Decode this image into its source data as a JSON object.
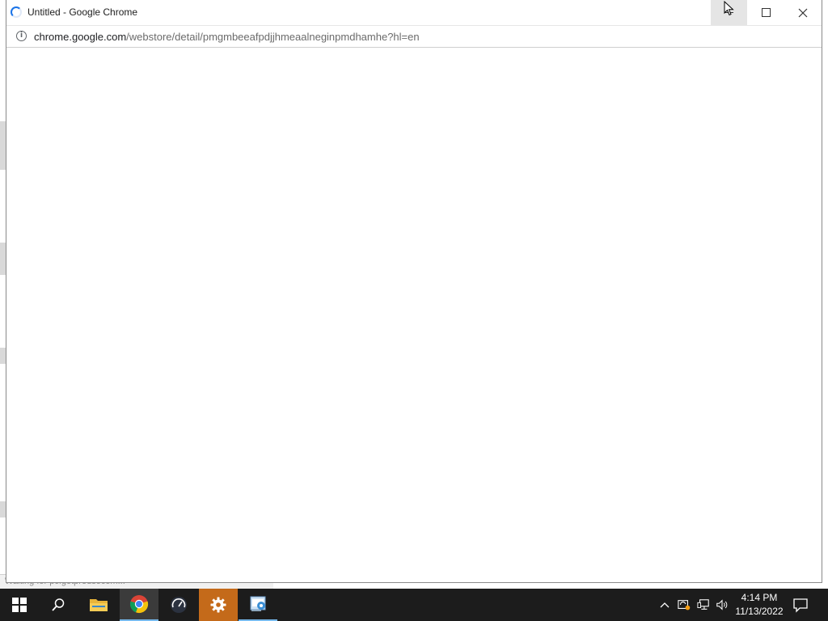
{
  "window": {
    "title": "Untitled - Google Chrome",
    "url_host": "chrome.google.com",
    "url_path": "/webstore/detail/pmgmbeeafpdjjhmeaalneginpmdhamhe?hl=en",
    "minimize_symbol": "—",
    "close_symbol": "✕"
  },
  "background_status": "Waiting for pcfgotpredsocom...",
  "taskbar": {
    "items": [
      "windows-start",
      "search",
      "file-explorer",
      "chrome",
      "speedometer",
      "settings",
      "control-panel"
    ],
    "clock_time": "4:14 PM",
    "clock_date": "11/13/2022"
  },
  "colors": {
    "taskbar_bg": "#1c1c1c",
    "settings_tile": "#c46a1a",
    "accent": "#76b9ed",
    "spinner": "#1a73e8"
  }
}
